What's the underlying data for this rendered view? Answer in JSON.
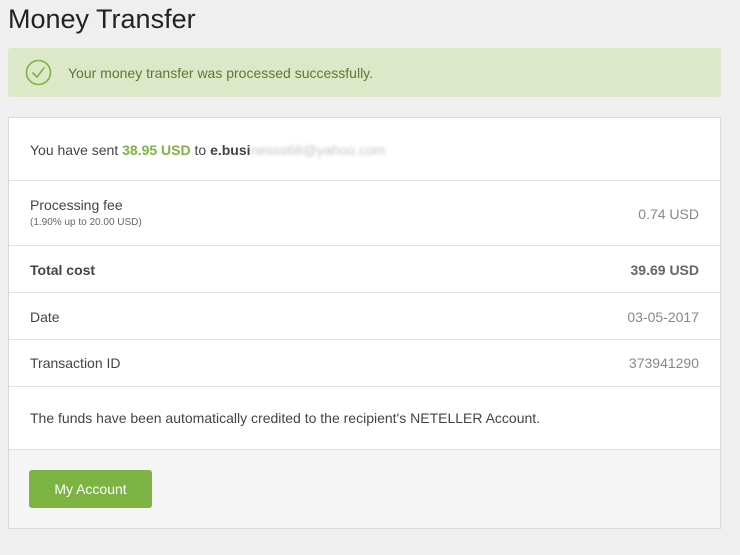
{
  "page": {
    "title": "Money Transfer"
  },
  "alert": {
    "icon": "check-circle-icon",
    "message": "Your money transfer was processed successfully.",
    "color": "#5a7a32",
    "background": "#dde8c8"
  },
  "summary": {
    "prefix": "You have sent ",
    "amount": "38.95 USD",
    "connector": " to ",
    "recipient_visible": "e.busi",
    "recipient_redacted": "nesss68@yahoo.com"
  },
  "details": {
    "fee_label": "Processing fee",
    "fee_note": "(1.90% up to 20.00 USD)",
    "fee_value": "0.74 USD",
    "total_label": "Total cost",
    "total_value": "39.69 USD",
    "date_label": "Date",
    "date_value": "03-05-2017",
    "txn_label": "Transaction ID",
    "txn_value": "373941290"
  },
  "note": "The funds have been automatically credited to the recipient's NETELLER Account.",
  "actions": {
    "my_account_label": "My Account",
    "accent_color": "#7cb342"
  }
}
